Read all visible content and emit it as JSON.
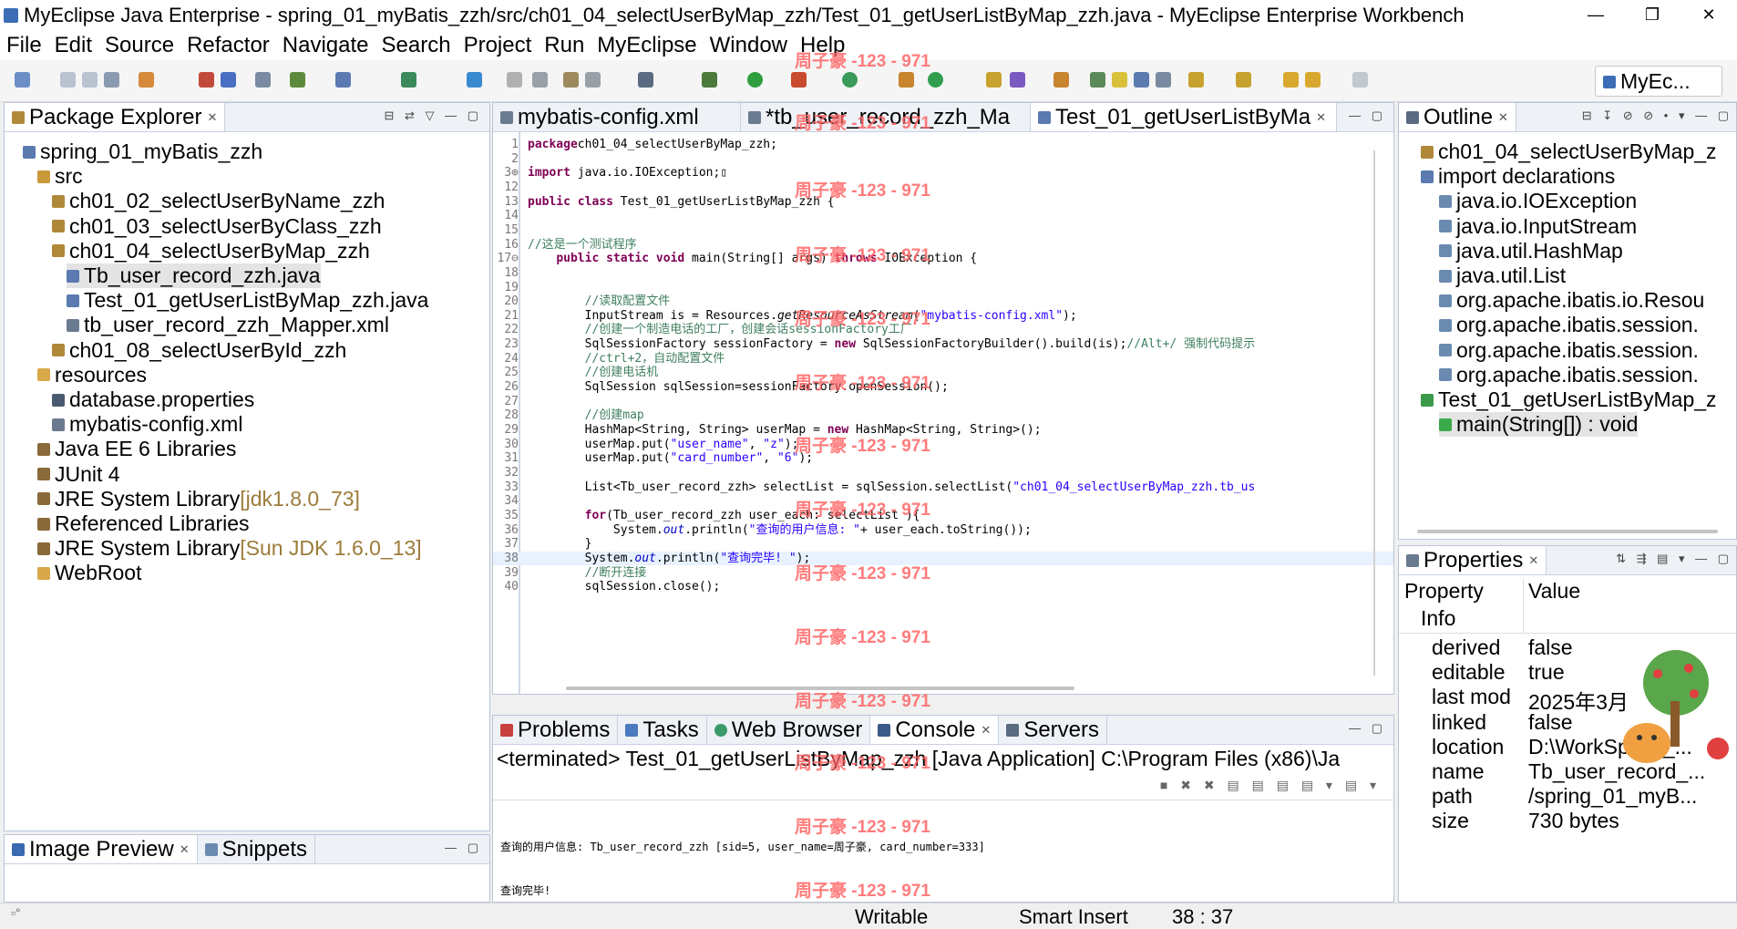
{
  "window": {
    "title": "MyEclipse Java Enterprise - spring_01_myBatis_zzh/src/ch01_04_selectUserByMap_zzh/Test_01_getUserListByMap_zzh.java - MyEclipse Enterprise Workbench",
    "min": "—",
    "max": "❐",
    "close": "✕"
  },
  "menu": [
    "File",
    "Edit",
    "Source",
    "Refactor",
    "Navigate",
    "Search",
    "Project",
    "Run",
    "MyEclipse",
    "Window",
    "Help"
  ],
  "perspective": "MyEc...",
  "package_explorer": {
    "title": "Package Explorer",
    "rows": [
      {
        "label": "spring_01_myBatis_zzh",
        "suffix": "",
        "indent": 0,
        "icon": "project-icon"
      },
      {
        "label": "src",
        "suffix": "",
        "indent": 1,
        "icon": "source-folder-icon"
      },
      {
        "label": "ch01_02_selectUserByName_zzh",
        "suffix": "",
        "indent": 2,
        "icon": "package-icon"
      },
      {
        "label": "ch01_03_selectUserByClass_zzh",
        "suffix": "",
        "indent": 2,
        "icon": "package-icon"
      },
      {
        "label": "ch01_04_selectUserByMap_zzh",
        "suffix": "",
        "indent": 2,
        "icon": "package-icon"
      },
      {
        "label": "Tb_user_record_zzh.java",
        "suffix": "",
        "indent": 3,
        "icon": "java-file-icon",
        "selected": true
      },
      {
        "label": "Test_01_getUserListByMap_zzh.java",
        "suffix": "",
        "indent": 3,
        "icon": "java-file-icon"
      },
      {
        "label": "tb_user_record_zzh_Mapper.xml",
        "suffix": "",
        "indent": 3,
        "icon": "xml-file-icon"
      },
      {
        "label": "ch01_08_selectUserById_zzh",
        "suffix": "",
        "indent": 2,
        "icon": "package-icon"
      },
      {
        "label": "resources",
        "suffix": "",
        "indent": 1,
        "icon": "folder-icon"
      },
      {
        "label": "database.properties",
        "suffix": "",
        "indent": 2,
        "icon": "properties-file-icon"
      },
      {
        "label": "mybatis-config.xml",
        "suffix": "",
        "indent": 2,
        "icon": "xml-file-icon"
      },
      {
        "label": "Java EE 6 Libraries",
        "suffix": "",
        "indent": 1,
        "icon": "library-icon"
      },
      {
        "label": "JUnit 4",
        "suffix": "",
        "indent": 1,
        "icon": "library-icon"
      },
      {
        "label": "JRE System Library ",
        "suffix": "[jdk1.8.0_73]",
        "indent": 1,
        "icon": "library-icon"
      },
      {
        "label": "Referenced Libraries",
        "suffix": "",
        "indent": 1,
        "icon": "library-icon"
      },
      {
        "label": "JRE System Library ",
        "suffix": "[Sun JDK 1.6.0_13]",
        "indent": 1,
        "icon": "library-icon"
      },
      {
        "label": "WebRoot",
        "suffix": "",
        "indent": 1,
        "icon": "folder-icon"
      }
    ]
  },
  "image_preview": {
    "tab1": "Image Preview",
    "tab2": "Snippets"
  },
  "editor": {
    "tabs": [
      {
        "label": "mybatis-config.xml",
        "active": false
      },
      {
        "label": "*tb_user_record_zzh_Ma",
        "active": false
      },
      {
        "label": "Test_01_getUserListByMa",
        "active": true
      }
    ],
    "lines": [
      {
        "n": "1",
        "parts": [
          [
            "kw",
            "package"
          ],
          [
            "",
            "ch01_04_selectUserByMap_zzh;"
          ]
        ]
      },
      {
        "n": "2",
        "parts": []
      },
      {
        "n": "3⊕",
        "parts": [
          [
            "kw",
            "import"
          ],
          [
            "",
            " java.io.IOException;▯"
          ]
        ]
      },
      {
        "n": "12",
        "parts": []
      },
      {
        "n": "13",
        "parts": [
          [
            "kw",
            "public class"
          ],
          [
            "",
            " Test_01_getUserListByMap_zzh {"
          ]
        ]
      },
      {
        "n": "14",
        "parts": []
      },
      {
        "n": "15",
        "parts": []
      },
      {
        "n": "16",
        "parts": [
          [
            "cm",
            "//这是一个测试程序"
          ]
        ]
      },
      {
        "n": "17⊖",
        "parts": [
          [
            "",
            "    "
          ],
          [
            "kw",
            "public static void"
          ],
          [
            "",
            " main(String[] args) "
          ],
          [
            "kw",
            "throws"
          ],
          [
            "",
            " IOException {"
          ]
        ]
      },
      {
        "n": "18",
        "parts": []
      },
      {
        "n": "19",
        "parts": []
      },
      {
        "n": "20",
        "parts": [
          [
            "",
            "        "
          ],
          [
            "cm",
            "//读取配置文件"
          ]
        ]
      },
      {
        "n": "21",
        "parts": [
          [
            "",
            "        InputStream is = Resources."
          ],
          [
            "it",
            "getResourceAsStream"
          ],
          [
            "",
            "("
          ],
          [
            "st",
            "\"mybatis-config.xml\""
          ],
          [
            "",
            ");"
          ]
        ]
      },
      {
        "n": "22",
        "parts": [
          [
            "",
            "        "
          ],
          [
            "cm",
            "//创建一个制造电话的工厂，创建会话sessionFactory工厂"
          ]
        ]
      },
      {
        "n": "23",
        "parts": [
          [
            "",
            "        SqlSessionFactory sessionFactory = "
          ],
          [
            "kw",
            "new"
          ],
          [
            "",
            " SqlSessionFactoryBuilder().build(is);"
          ],
          [
            "cm",
            "//Alt+/ 强制代码提示"
          ]
        ]
      },
      {
        "n": "24",
        "parts": [
          [
            "",
            "        "
          ],
          [
            "cm",
            "//ctrl+2，自动配置文件"
          ]
        ]
      },
      {
        "n": "25",
        "parts": [
          [
            "",
            "        "
          ],
          [
            "cm",
            "//创建电话机"
          ]
        ]
      },
      {
        "n": "26",
        "parts": [
          [
            "",
            "        SqlSession sqlSession=sessionFactory.openSession();"
          ]
        ]
      },
      {
        "n": "27",
        "parts": []
      },
      {
        "n": "28",
        "parts": [
          [
            "",
            "        "
          ],
          [
            "cm",
            "//创建map"
          ]
        ]
      },
      {
        "n": "29",
        "parts": [
          [
            "",
            "        HashMap<String, String> userMap = "
          ],
          [
            "kw",
            "new"
          ],
          [
            "",
            " HashMap<String, String>();"
          ]
        ]
      },
      {
        "n": "30",
        "parts": [
          [
            "",
            "        userMap.put("
          ],
          [
            "st",
            "\"user_name\""
          ],
          [
            "",
            ", "
          ],
          [
            "st",
            "\"z\""
          ],
          [
            "",
            ");"
          ]
        ]
      },
      {
        "n": "31",
        "parts": [
          [
            "",
            "        userMap.put("
          ],
          [
            "st",
            "\"card_number\""
          ],
          [
            "",
            ", "
          ],
          [
            "st",
            "\"6\""
          ],
          [
            "",
            ");"
          ]
        ]
      },
      {
        "n": "32",
        "parts": []
      },
      {
        "n": "33",
        "parts": [
          [
            "",
            "        List<Tb_user_record_zzh> selectList = sqlSession.selectList("
          ],
          [
            "st",
            "\"ch01_04_selectUserByMap_zzh.tb_us"
          ]
        ]
      },
      {
        "n": "34",
        "parts": []
      },
      {
        "n": "35",
        "parts": [
          [
            "",
            "        "
          ],
          [
            "kw",
            "for"
          ],
          [
            "",
            "(Tb_user_record_zzh user_each: selectList ){"
          ]
        ]
      },
      {
        "n": "36",
        "parts": [
          [
            "",
            "            System."
          ],
          [
            "fd",
            "out"
          ],
          [
            "",
            ".println("
          ],
          [
            "st",
            "\"查询的用户信息: \""
          ],
          [
            "",
            "+ user_each.toString());"
          ]
        ]
      },
      {
        "n": "37",
        "parts": [
          [
            "",
            "        }"
          ]
        ]
      },
      {
        "n": "38",
        "parts": [
          [
            "",
            "        System."
          ],
          [
            "fd",
            "out"
          ],
          [
            "",
            ".println("
          ],
          [
            "st",
            "\"查询完毕! \""
          ],
          [
            "",
            ");"
          ]
        ],
        "current": true
      },
      {
        "n": "39",
        "parts": [
          [
            "",
            "        "
          ],
          [
            "cm",
            "//断开连接"
          ]
        ]
      },
      {
        "n": "40",
        "parts": [
          [
            "",
            "        sqlSession.close();"
          ]
        ]
      }
    ]
  },
  "outline": {
    "title": "Outline",
    "rows": [
      {
        "label": "ch01_04_selectUserByMap_z",
        "indent": 0,
        "icon": "package-icon"
      },
      {
        "label": "import declarations",
        "indent": 0,
        "icon": "imports-icon"
      },
      {
        "label": "java.io.IOException",
        "indent": 1,
        "icon": "import-icon"
      },
      {
        "label": "java.io.InputStream",
        "indent": 1,
        "icon": "import-icon"
      },
      {
        "label": "java.util.HashMap",
        "indent": 1,
        "icon": "import-icon"
      },
      {
        "label": "java.util.List",
        "indent": 1,
        "icon": "import-icon"
      },
      {
        "label": "org.apache.ibatis.io.Resou",
        "indent": 1,
        "icon": "import-icon"
      },
      {
        "label": "org.apache.ibatis.session.",
        "indent": 1,
        "icon": "import-icon"
      },
      {
        "label": "org.apache.ibatis.session.",
        "indent": 1,
        "icon": "import-icon"
      },
      {
        "label": "org.apache.ibatis.session.",
        "indent": 1,
        "icon": "import-icon"
      },
      {
        "label": "Test_01_getUserListByMap_z",
        "indent": 0,
        "icon": "class-icon"
      },
      {
        "label": "main(String[]) : void",
        "indent": 1,
        "icon": "method-icon",
        "selected": true
      }
    ]
  },
  "properties": {
    "title": "Properties",
    "col_property": "Property",
    "col_value": "Value",
    "group": "Info",
    "rows": [
      {
        "k": "derived",
        "v": "false"
      },
      {
        "k": "editable",
        "v": "true"
      },
      {
        "k": "last mod",
        "v": "2025年3月"
      },
      {
        "k": "linked",
        "v": "false"
      },
      {
        "k": "location",
        "v": "D:\\WorkSpace_..."
      },
      {
        "k": "name",
        "v": "Tb_user_record_..."
      },
      {
        "k": "path",
        "v": "/spring_01_myB..."
      },
      {
        "k": "size",
        "v": "730  bytes"
      }
    ]
  },
  "bottom": {
    "tabs": [
      "Problems",
      "Tasks",
      "Web Browser",
      "Console",
      "Servers"
    ],
    "active": "Console",
    "terminated": "<terminated> Test_01_getUserListByMap_zzh [Java Application] C:\\Program Files (x86)\\Ja",
    "output": [
      "查询的用户信息: Tb_user_record_zzh [sid=5, user_name=周子豪, card_number=333]",
      "查询完毕!"
    ]
  },
  "status": {
    "writable": "Writable",
    "insert": "Smart Insert",
    "position": "38 : 37"
  },
  "watermark": "周子豪 -123 - 971"
}
